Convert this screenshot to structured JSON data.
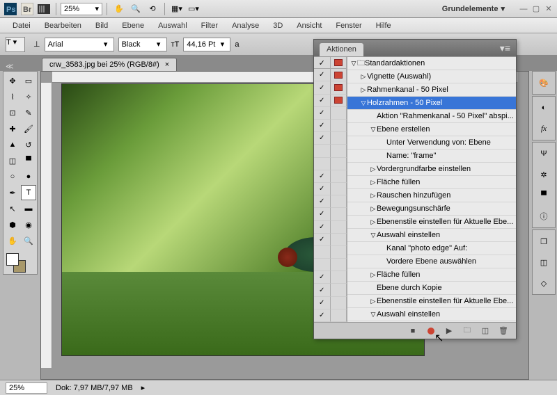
{
  "topbar": {
    "zoom": "25%",
    "workspace": "Grundelemente"
  },
  "menu": [
    "Datei",
    "Bearbeiten",
    "Bild",
    "Ebene",
    "Auswahl",
    "Filter",
    "Analyse",
    "3D",
    "Ansicht",
    "Fenster",
    "Hilfe"
  ],
  "options": {
    "font": "Arial",
    "weight": "Black",
    "size": "44,16 Pt"
  },
  "tab": {
    "title": "crw_3583.jpg bei 25% (RGB/8#)"
  },
  "status": {
    "zoom": "25%",
    "doc": "Dok: 7,97 MB/7,97 MB"
  },
  "actions": {
    "title": "Aktionen",
    "header": {
      "c1": "✓",
      "c2": "□"
    },
    "rows": [
      {
        "check": true,
        "dlg": true,
        "indent": 0,
        "tri": "▽",
        "icon": "folder",
        "label": "Standardaktionen",
        "sel": false
      },
      {
        "check": true,
        "dlg": true,
        "indent": 1,
        "tri": "▷",
        "label": "Vignette (Auswahl)",
        "sel": false
      },
      {
        "check": true,
        "dlg": true,
        "indent": 1,
        "tri": "▷",
        "label": "Rahmenkanal - 50 Pixel",
        "sel": false
      },
      {
        "check": true,
        "dlg": false,
        "indent": 1,
        "tri": "▽",
        "label": "Holzrahmen - 50 Pixel",
        "sel": true
      },
      {
        "check": true,
        "dlg": false,
        "indent": 2,
        "tri": "",
        "label": "Aktion \"Rahmenkanal - 50 Pixel\" abspi...",
        "sel": false
      },
      {
        "check": true,
        "dlg": false,
        "indent": 2,
        "tri": "▽",
        "label": "Ebene erstellen",
        "sel": false
      },
      {
        "check": false,
        "dlg": false,
        "indent": 3,
        "tri": "",
        "label": "Unter Verwendung von: Ebene",
        "sel": false
      },
      {
        "check": false,
        "dlg": false,
        "indent": 3,
        "tri": "",
        "label": "Name:  \"frame\"",
        "sel": false
      },
      {
        "check": true,
        "dlg": false,
        "indent": 2,
        "tri": "▷",
        "label": "Vordergrundfarbe einstellen",
        "sel": false
      },
      {
        "check": true,
        "dlg": false,
        "indent": 2,
        "tri": "▷",
        "label": "Fläche füllen",
        "sel": false
      },
      {
        "check": true,
        "dlg": false,
        "indent": 2,
        "tri": "▷",
        "label": "Rauschen hinzufügen",
        "sel": false
      },
      {
        "check": true,
        "dlg": false,
        "indent": 2,
        "tri": "▷",
        "label": "Bewegungsunschärfe",
        "sel": false
      },
      {
        "check": true,
        "dlg": false,
        "indent": 2,
        "tri": "▷",
        "label": "Ebenenstile einstellen  für Aktuelle Ebe...",
        "sel": false
      },
      {
        "check": true,
        "dlg": false,
        "indent": 2,
        "tri": "▽",
        "label": "Auswahl einstellen",
        "sel": false
      },
      {
        "check": false,
        "dlg": false,
        "indent": 3,
        "tri": "",
        "label": "Kanal \"photo edge\" Auf:",
        "sel": false
      },
      {
        "check": false,
        "dlg": false,
        "indent": 3,
        "tri": "",
        "label": "Vordere Ebene auswählen",
        "sel": false
      },
      {
        "check": true,
        "dlg": false,
        "indent": 2,
        "tri": "▷",
        "label": "Fläche füllen",
        "sel": false
      },
      {
        "check": true,
        "dlg": false,
        "indent": 2,
        "tri": "",
        "label": "Ebene durch Kopie",
        "sel": false
      },
      {
        "check": true,
        "dlg": false,
        "indent": 2,
        "tri": "▷",
        "label": "Ebenenstile einstellen  für Aktuelle Ebe...",
        "sel": false
      },
      {
        "check": true,
        "dlg": false,
        "indent": 2,
        "tri": "▽",
        "label": "Auswahl einstellen",
        "sel": false
      }
    ]
  }
}
